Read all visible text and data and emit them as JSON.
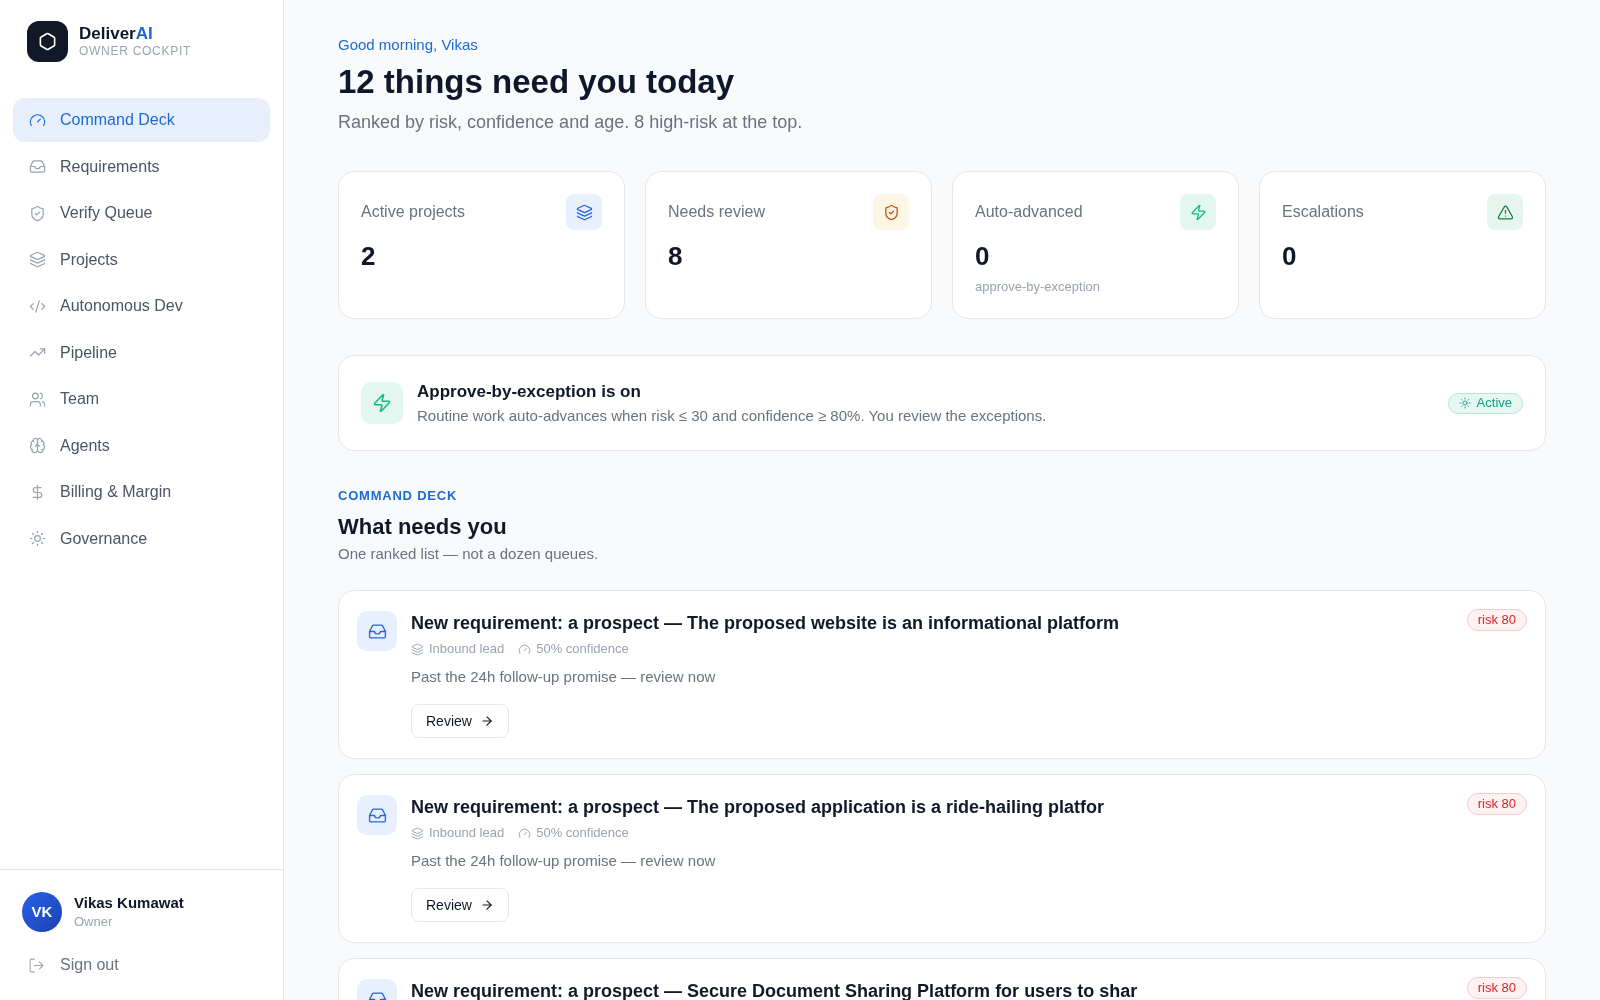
{
  "sidebar": {
    "brand": {
      "name": "Deliver",
      "accent": "AI",
      "subtitle": "OWNER COCKPIT"
    },
    "nav": [
      {
        "label": "Command Deck",
        "selected": true
      },
      {
        "label": "Requirements",
        "selected": false
      },
      {
        "label": "Verify Queue",
        "selected": false
      },
      {
        "label": "Projects",
        "selected": false
      },
      {
        "label": "Autonomous Dev",
        "selected": false
      },
      {
        "label": "Pipeline",
        "selected": false
      },
      {
        "label": "Team",
        "selected": false
      },
      {
        "label": "Agents",
        "selected": false
      },
      {
        "label": "Billing & Margin",
        "selected": false
      },
      {
        "label": "Governance",
        "selected": false
      }
    ],
    "user": {
      "initials": "VK",
      "name": "Vikas Kumawat",
      "role": "Owner"
    },
    "sign_out": "Sign out"
  },
  "header": {
    "greeting": "Good morning, Vikas",
    "title": "12 things need you today",
    "subtitle": "Ranked by risk, confidence and age. 8 high-risk at the top."
  },
  "stats": [
    {
      "label": "Active projects",
      "value": "2"
    },
    {
      "label": "Needs review",
      "value": "8"
    },
    {
      "label": "Auto-advanced",
      "value": "0",
      "note": "approve-by-exception"
    },
    {
      "label": "Escalations",
      "value": "0"
    }
  ],
  "banner": {
    "title": "Approve-by-exception is on",
    "description": "Routine work auto-advances when risk ≤ 30 and confidence ≥ 80%. You review the exceptions.",
    "status": "Active"
  },
  "section": {
    "eyebrow": "COMMAND DECK",
    "title": "What needs you",
    "subtitle": "One ranked list — not a dozen queues."
  },
  "items": [
    {
      "title": "New requirement: a prospect — The proposed website is an informational platform",
      "source": "Inbound lead",
      "confidence": "50% confidence",
      "note": "Past the 24h follow-up promise — review now",
      "action": "Review",
      "risk": "risk 80"
    },
    {
      "title": "New requirement: a prospect — The proposed application is a ride-hailing platfor",
      "source": "Inbound lead",
      "confidence": "50% confidence",
      "note": "Past the 24h follow-up promise — review now",
      "action": "Review",
      "risk": "risk 80"
    },
    {
      "title": "New requirement: a prospect — Secure Document Sharing Platform for users to shar",
      "risk": "risk 80"
    }
  ]
}
